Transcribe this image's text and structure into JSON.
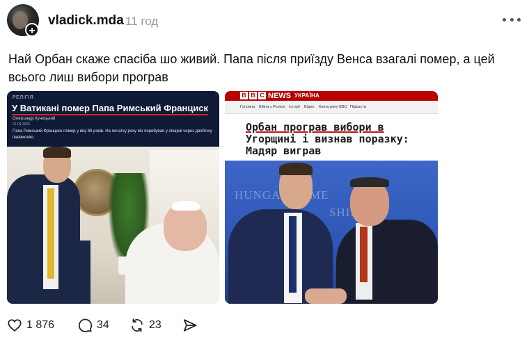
{
  "post": {
    "username": "vladick.mda",
    "time": "11 год",
    "text": "Най Орбан скаже спасіба шо живий. Папа після приїзду Венса взагалі помер, а цей всього лиш вибори програв"
  },
  "media": {
    "image1": {
      "tag": "РЕЛІГІЯ",
      "headline": "У Ватикані помер Папа Римський Франциск",
      "author": "Олександр Куницький",
      "date": "21.04.2025",
      "lede": "Папа Римський Франциск помер у віці 88 років. На початку року він перебував у лікарні через двобічну пневмонію."
    },
    "image2": {
      "logo_letters": [
        "B",
        "B",
        "C"
      ],
      "brand": "NEWS",
      "edition": "УКРАЇНА",
      "nav": [
        "Головна",
        "Війна з Росією",
        "Історії",
        "Відео",
        "Книга року BBC",
        "Підкасти"
      ],
      "headline_lines": [
        "Орбан програв вибори в",
        "Угорщині і визнав поразку:",
        "Мадяр виграв"
      ],
      "backdrop_text_1": "HUNGARY AME",
      "backdrop_text_2": "SHIP"
    }
  },
  "actions": {
    "likes": "1 876",
    "comments": "34",
    "reposts": "23"
  },
  "icons": {
    "like": "heart-icon",
    "comment": "comment-icon",
    "repost": "repost-icon",
    "share": "share-icon",
    "more": "more-icon",
    "follow": "plus-icon"
  }
}
